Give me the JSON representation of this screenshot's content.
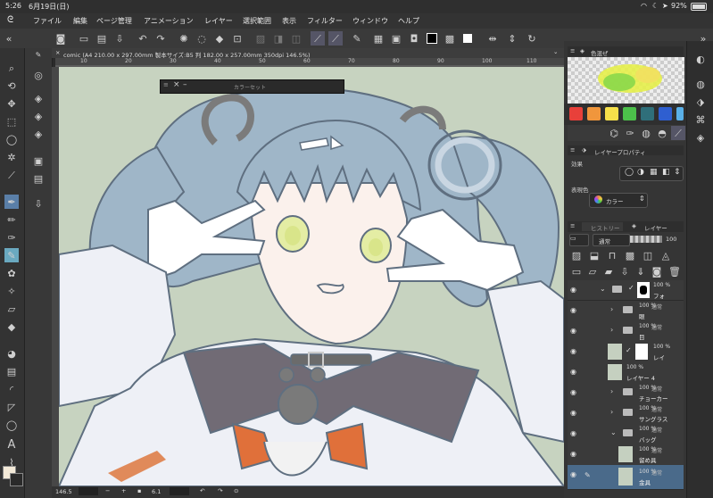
{
  "status_bar": {
    "time": "5:26",
    "date": "6月19日(日)",
    "battery": "92%",
    "icons": [
      "wifi-icon",
      "moon-icon",
      "location-icon",
      "battery-icon"
    ]
  },
  "menu": {
    "items": [
      "ファイル",
      "編集",
      "ページ管理",
      "アニメーション",
      "レイヤー",
      "選択範囲",
      "表示",
      "フィルター",
      "ウィンドウ",
      "ヘルプ"
    ]
  },
  "document": {
    "tab_title": "comic (A4 210.00 x 297.00mm 製本サイズ:B5 判 182.00 x 257.00mm 350dpi 146.5%)",
    "ruler_marks": [
      "10",
      "20",
      "30",
      "40",
      "50",
      "60",
      "70",
      "80",
      "90",
      "100",
      "110"
    ]
  },
  "floating_palette": {
    "title": "カラーセット"
  },
  "color_wheel_panel": {
    "title": "色混ぜ"
  },
  "color_swatches": [
    "#e8403a",
    "#f0963c",
    "#f6e04a",
    "#4cc04a",
    "#2f6f7a",
    "#2f5fd0",
    "#5ab0e8"
  ],
  "layer_property": {
    "title": "レイヤープロパティ",
    "effect_label": "効果",
    "expression_color_label": "表現色",
    "expression_color_value": "カラー"
  },
  "layer_panel": {
    "tabs": [
      "ヒストリー",
      "レイヤー"
    ],
    "blend_mode": "通常",
    "opacity": "100",
    "layers": [
      {
        "opacity": "100 %",
        "mode": "通常",
        "name": "フォ"
      },
      {
        "opacity": "100 %",
        "mode": "通常",
        "name": "眼"
      },
      {
        "opacity": "100 %",
        "mode": "通常",
        "name": "目"
      },
      {
        "opacity": "100 %",
        "mode": "通常",
        "name": "レイ"
      },
      {
        "opacity": "100 %",
        "mode": "通常",
        "name": "レイヤー 4"
      },
      {
        "opacity": "100 %",
        "mode": "通常",
        "name": "チョーカー"
      },
      {
        "opacity": "100 %",
        "mode": "通常",
        "name": "サングラス"
      },
      {
        "opacity": "100 %",
        "mode": "通常",
        "name": "バッグ"
      },
      {
        "opacity": "100 %",
        "mode": "通常",
        "name": "留め具"
      },
      {
        "opacity": "100 %",
        "mode": "通常",
        "name": "金具"
      }
    ]
  },
  "bottom_bar": {
    "zoom": "146.5",
    "angle": "6.1"
  },
  "colors": {
    "canvas_bg": "#c7d3c0",
    "hair": "#9fb6c8",
    "line": "#5f6f80",
    "accent_orange": "#e0703a",
    "selected_layer": "#4a6a8a"
  }
}
